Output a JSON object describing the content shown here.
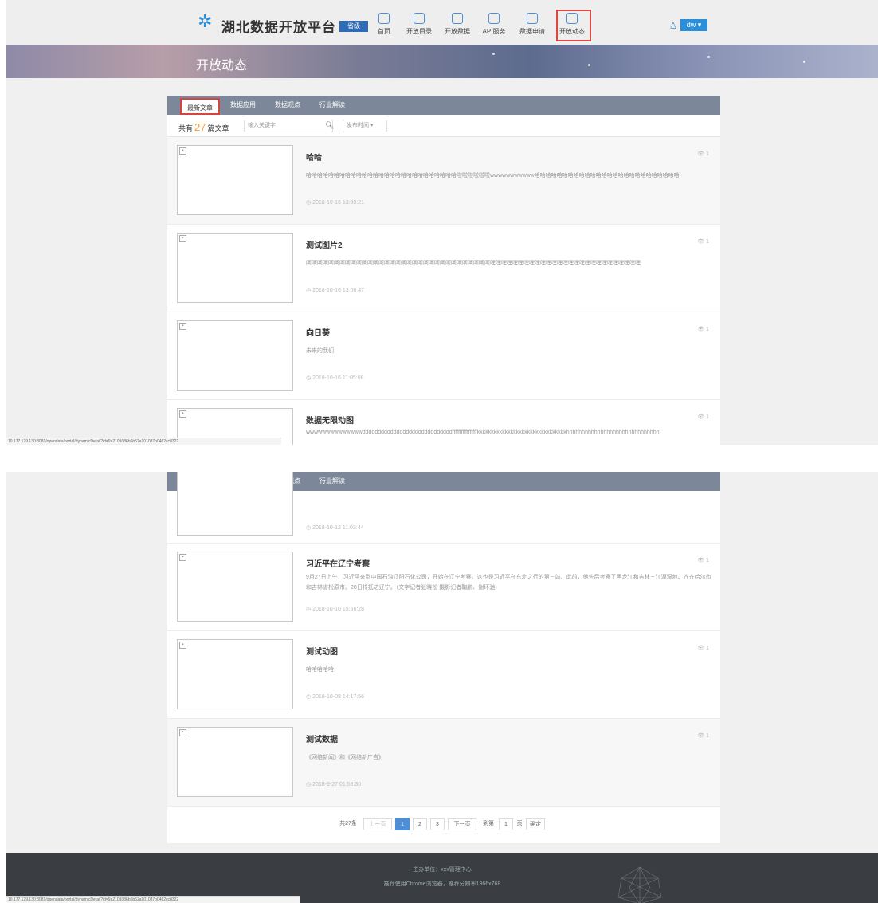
{
  "header": {
    "site_title": "湖北数据开放平台",
    "city_select": "省级",
    "nav": [
      {
        "label": "首页"
      },
      {
        "label": "开放目录"
      },
      {
        "label": "开放数据"
      },
      {
        "label": "API服务"
      },
      {
        "label": "数据申请"
      },
      {
        "label": "开放动态"
      }
    ],
    "user": "dw"
  },
  "banner": {
    "title": "开放动态"
  },
  "tabs": [
    "最新文章",
    "数据应用",
    "数据观点",
    "行业解读"
  ],
  "count": {
    "prefix": "共有",
    "number": "27",
    "suffix": "篇文章"
  },
  "search": {
    "placeholder": "输入关键字"
  },
  "sort": {
    "value": "发布时间"
  },
  "articles_top": [
    {
      "title": "哈哈",
      "summary": "哈哈哈哈哈哈哈哈哈哈哈哈哈哈哈哈哈哈哈哈哈哈哈哈哈哈哈啦啦啦啦啦啦wwwwwwwwwww哈哈哈哈哈哈哈哈哈哈哈哈哈哈哈哈哈哈哈哈哈哈哈哈哈哈",
      "date": "2018-10-16 13:39:21",
      "views": "1"
    },
    {
      "title": "测试图片2",
      "summary": "呵呵呵呵呵呵呵呵呵呵呵呵呵呵呵呵呵呵呵呵呵呵呵呵呵呵呵呵呵呵呵呵呵嘿嘿嘿嘿嘿嘿嘿嘿嘿嘿嘿嘿嘿嘿嘿嘿嘿嘿嘿嘿嘿嘿嘿嘿嘿嘿嘿",
      "date": "2018-10-16 13:06:47",
      "views": "1"
    },
    {
      "title": "向日葵",
      "summary": "未来的我们",
      "date": "2018-10-16 11:05:08",
      "views": "1"
    },
    {
      "title": "数据无限动图",
      "summary": "wwwwwwwwwwwwwwdddddddddddddddddddddddddddddfffffffffffffffffkkkkkkkkkkkkkkkkkkkkkkkkkkkkkkkkhhhhhhhhhhhhhhhhhhhhhhhhhhhhhh",
      "date": "",
      "views": "1"
    }
  ],
  "articles_bottom": [
    {
      "title": "",
      "summary": "",
      "date": "2018-10-12 11:03:44",
      "views": ""
    },
    {
      "title": "习近平在辽宁考察",
      "summary": "9月27日上午，习近平来到中国石油辽阳石化公司，开始在辽宁考察。这也是习近平在东北之行的第三站。此前，他先后考察了黑龙江和吉林三江源湿地、齐齐哈尔市和吉林省松原市。28日将抵达辽宁。（文字记者张晓松 摄影记者鞠鹏、谢环驰）",
      "date": "2018-10-10 15:56:28",
      "views": "1"
    },
    {
      "title": "测试动图",
      "summary": "哈哈哈哈哈",
      "date": "2018-10-08 14:17:56",
      "views": "1"
    },
    {
      "title": "测试数据",
      "summary": "《网络新闻》和《网络新广告》",
      "date": "2018-9-27 01:58:30",
      "views": "1"
    }
  ],
  "pagination": {
    "total": "共27条",
    "prev": "上一页",
    "pages": [
      "1",
      "2",
      "3"
    ],
    "next": "下一页",
    "goto_label": "到第",
    "page_input": "1",
    "page_unit": "页",
    "confirm": "确定"
  },
  "status_url": "10.177.129.130:8081/opendata/portal/dynamicDetail?id=9a2101086b6b52a101087b0462cc8322",
  "footer": {
    "line1": "主办单位：xxx管理中心",
    "line2": "推荐使用Chrome浏览器，推荐分辨率1366x768"
  }
}
